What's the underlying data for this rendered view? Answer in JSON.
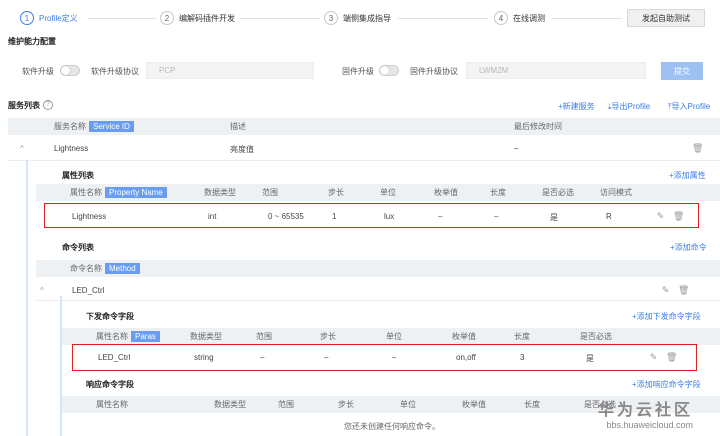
{
  "steps": [
    {
      "num": "1",
      "label": "Profile定义"
    },
    {
      "num": "2",
      "label": "编解码插件开发"
    },
    {
      "num": "3",
      "label": "端侧集成指导"
    },
    {
      "num": "4",
      "label": "在线调测"
    }
  ],
  "test_button": "发起自助测试",
  "maintenance": {
    "title": "维护能力配置",
    "software_upgrade": "软件升级",
    "software_protocol": "软件升级协议",
    "software_protocol_value": "PCP",
    "firmware_upgrade": "固件升级",
    "firmware_protocol": "固件升级协议",
    "firmware_protocol_value": "LWM2M",
    "submit": "提交"
  },
  "services": {
    "title": "服务列表",
    "new_service": "+新建服务",
    "export_profile": "导出Profile",
    "import_profile": "导入Profile",
    "headers": {
      "name": "服务名称",
      "tag": "Service ID",
      "desc": "描述",
      "modified": "最后修改时间"
    },
    "row": {
      "name": "Lightness",
      "desc": "亮度值",
      "modified": "–"
    }
  },
  "properties": {
    "title": "属性列表",
    "add": "+添加属性",
    "headers": {
      "name": "属性名称",
      "tag": "Property Name",
      "type": "数据类型",
      "range": "范围",
      "step": "步长",
      "unit": "单位",
      "enum": "枚举值",
      "length": "长度",
      "required": "是否必选",
      "access": "访问模式"
    },
    "row": {
      "name": "Lightness",
      "type": "int",
      "range": "0 ~ 65535",
      "step": "1",
      "unit": "lux",
      "enum": "–",
      "length": "–",
      "required": "是",
      "access": "R"
    }
  },
  "commands": {
    "title": "命令列表",
    "add": "+添加命令",
    "headers": {
      "name": "命令名称",
      "tag": "Method"
    },
    "row": {
      "name": "LED_Ctrl"
    }
  },
  "down_fields": {
    "title": "下发命令字段",
    "add": "+添加下发命令字段",
    "headers": {
      "name": "属性名称",
      "tag": "Paras",
      "type": "数据类型",
      "range": "范围",
      "step": "步长",
      "unit": "单位",
      "enum": "枚举值",
      "length": "长度",
      "required": "是否必选"
    },
    "row": {
      "name": "LED_Ctrl",
      "type": "string",
      "range": "–",
      "step": "–",
      "unit": "–",
      "enum": "on,off",
      "length": "3",
      "required": "是"
    }
  },
  "resp_fields": {
    "title": "响应命令字段",
    "add": "+添加响应命令字段",
    "headers": {
      "name": "属性名称",
      "type": "数据类型",
      "range": "范围",
      "step": "步长",
      "unit": "单位",
      "enum": "枚举值",
      "length": "长度",
      "required": "是否必选"
    },
    "empty": "您还未创建任何响应命令。"
  },
  "watermark": {
    "line1": "华为云社区",
    "line2": "bbs.huaweicloud.com"
  },
  "colors": {
    "accent": "#3b7de9",
    "highlight": "#e02020",
    "tag": "#6a9df0"
  }
}
